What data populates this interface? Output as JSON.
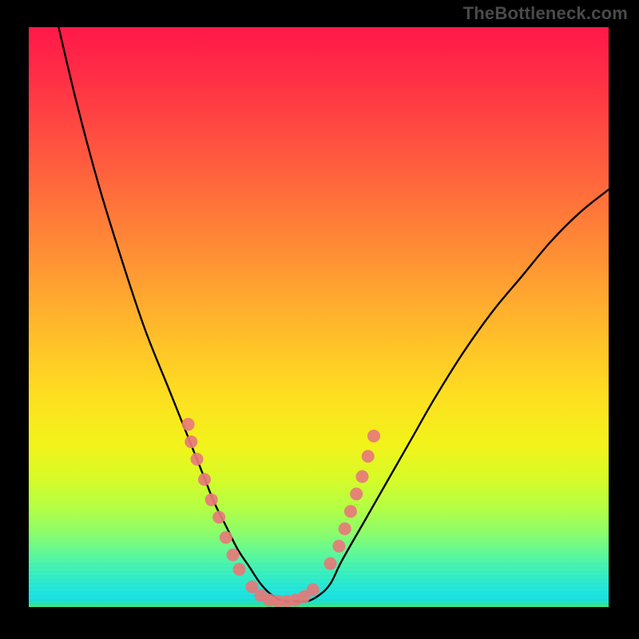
{
  "watermark": "TheBottleneck.com",
  "chart_data": {
    "type": "line",
    "title": "",
    "xlabel": "",
    "ylabel": "",
    "xlim": [
      0,
      100
    ],
    "ylim": [
      0,
      100
    ],
    "grid": false,
    "background_gradient": {
      "direction": "vertical",
      "stops": [
        {
          "pos": 0,
          "color": "#ff1848"
        },
        {
          "pos": 50,
          "color": "#ffc727"
        },
        {
          "pos": 75,
          "color": "#f2f31a"
        },
        {
          "pos": 90,
          "color": "#68f98f"
        },
        {
          "pos": 100,
          "color": "#3ee47f"
        }
      ]
    },
    "series": [
      {
        "name": "bottleneck-curve",
        "type": "line",
        "color": "#000000",
        "x": [
          4,
          8,
          12,
          16,
          20,
          24,
          26,
          28,
          30,
          32,
          34,
          36,
          38,
          40,
          42,
          44,
          46,
          48,
          50,
          52,
          54,
          58,
          62,
          66,
          70,
          75,
          80,
          85,
          90,
          95,
          100
        ],
        "y": [
          -5,
          12,
          27,
          40,
          52,
          62,
          67,
          72,
          77,
          82,
          86,
          90,
          93,
          96,
          98,
          99,
          99,
          99,
          98,
          96,
          92,
          85,
          78,
          71,
          64,
          56,
          49,
          43,
          37,
          32,
          28
        ]
      },
      {
        "name": "marker-cluster-left",
        "type": "scatter",
        "color": "#e77a7a",
        "radius": 8,
        "x": [
          27.5,
          28.0,
          29.0,
          30.3,
          31.5,
          32.8,
          34.0,
          35.2,
          36.3
        ],
        "y": [
          68.5,
          71.5,
          74.5,
          78.0,
          81.5,
          84.5,
          88.0,
          91.0,
          93.5
        ]
      },
      {
        "name": "marker-cluster-bottom",
        "type": "scatter",
        "color": "#e77a7a",
        "radius": 8,
        "x": [
          38.5,
          40.0,
          41.5,
          43.0,
          44.5,
          46.0,
          47.5,
          49.0
        ],
        "y": [
          96.5,
          98.0,
          98.8,
          99.0,
          99.0,
          98.8,
          98.2,
          97.0
        ]
      },
      {
        "name": "marker-cluster-right",
        "type": "scatter",
        "color": "#e77a7a",
        "radius": 8,
        "x": [
          52.0,
          53.5,
          54.5,
          55.5,
          56.5,
          57.5,
          58.5,
          59.5
        ],
        "y": [
          92.5,
          89.5,
          86.5,
          83.5,
          80.5,
          77.5,
          74.0,
          70.5
        ]
      }
    ],
    "legend": false
  }
}
